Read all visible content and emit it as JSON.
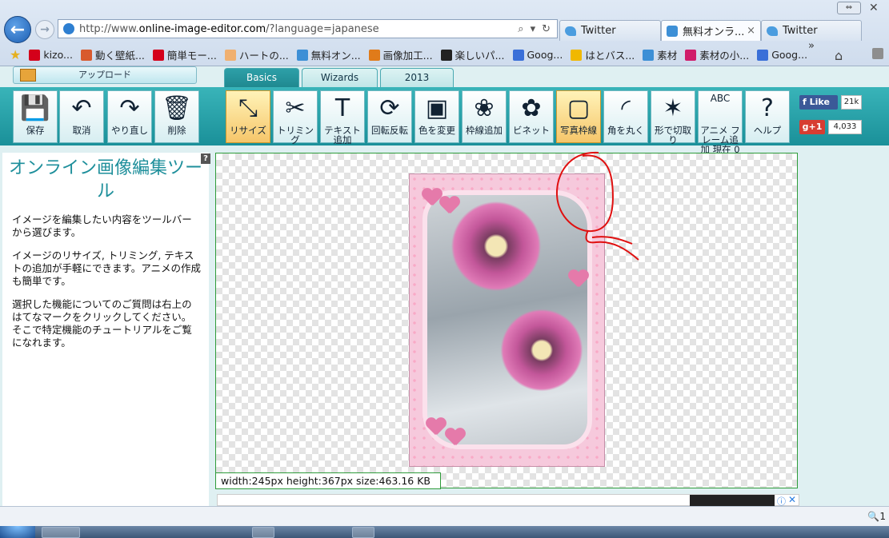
{
  "browser": {
    "url_prefix": "http://www.",
    "url_domain": "online-image-editor.com",
    "url_suffix": "/?language=japanese",
    "tabs": [
      {
        "label": "Twitter",
        "active": false
      },
      {
        "label": "無料オンラ...",
        "active": true
      },
      {
        "label": "Twitter",
        "active": false
      }
    ],
    "tab_close_glyph": "×",
    "favorites": [
      {
        "label": "kizo...",
        "icon": "yahoo-icon",
        "color": "#d4001a"
      },
      {
        "label": "動く壁紙...",
        "icon": "wallpaper-icon",
        "color": "#d85a2e"
      },
      {
        "label": "簡単モー...",
        "icon": "yahoo-icon",
        "color": "#d4001a"
      },
      {
        "label": "ハートの...",
        "icon": "face-icon",
        "color": "#f0b070"
      },
      {
        "label": "無料オン...",
        "icon": "ie-icon",
        "color": "#3c8fd6"
      },
      {
        "label": "画像加工...",
        "icon": "kakou-icon",
        "color": "#e07b1a"
      },
      {
        "label": "楽しいパ...",
        "icon": "x-icon",
        "color": "#222222"
      },
      {
        "label": "Goog...",
        "icon": "google-icon",
        "color": "#3a6fd8"
      },
      {
        "label": "はとバス...",
        "icon": "bus-icon",
        "color": "#f0b800"
      },
      {
        "label": "素材",
        "icon": "ie-icon",
        "color": "#3c8fd6"
      },
      {
        "label": "素材の小...",
        "icon": "m-icon",
        "color": "#d01c6a"
      },
      {
        "label": "Goog...",
        "icon": "google-icon",
        "color": "#3a6fd8"
      }
    ],
    "favorites_more": "»",
    "zoom": "1"
  },
  "editor": {
    "upload_label": "アップロード",
    "mode_tabs": [
      "Basics",
      "Wizards",
      "2013"
    ],
    "tools_left": [
      {
        "label": "保存",
        "icon": "save-icon",
        "glyph": "💾"
      },
      {
        "label": "取消",
        "icon": "undo-icon",
        "glyph": "↶"
      },
      {
        "label": "やり直し",
        "icon": "redo-icon",
        "glyph": "↷"
      },
      {
        "label": "削除",
        "icon": "delete-icon",
        "glyph": "🗑"
      }
    ],
    "tools_main": [
      {
        "label": "リサイズ",
        "icon": "resize-icon",
        "glyph": "⤡",
        "selected": true
      },
      {
        "label": "トリミング",
        "icon": "scissors-icon",
        "glyph": "✂",
        "selected": false
      },
      {
        "label": "テキスト追加",
        "icon": "text-add-icon",
        "glyph": "T",
        "selected": false
      },
      {
        "label": "回転反転",
        "icon": "rotate-icon",
        "glyph": "⟳",
        "selected": false
      },
      {
        "label": "色を変更",
        "icon": "color-change-icon",
        "glyph": "▣",
        "selected": false
      },
      {
        "label": "枠線追加",
        "icon": "border-icon",
        "glyph": "❀",
        "selected": false
      },
      {
        "label": "ビネット",
        "icon": "vignette-icon",
        "glyph": "✿",
        "selected": false
      },
      {
        "label": "写真枠線",
        "icon": "photo-frame-icon",
        "glyph": "▢",
        "selected": true
      },
      {
        "label": "角を丸く",
        "icon": "round-corner-icon",
        "glyph": "◜",
        "selected": false
      },
      {
        "label": "形で切取り",
        "icon": "shape-cut-icon",
        "glyph": "✶",
        "selected": false
      },
      {
        "label": "アニメ フレーム追加 現在 0",
        "icon": "animation-icon",
        "glyph": "ABC",
        "selected": false
      },
      {
        "label": "ヘルプ",
        "icon": "help-icon",
        "glyph": "?",
        "selected": false
      }
    ],
    "social": {
      "fb_label": "Like",
      "fb_count": "21k",
      "gplus_label": "+1",
      "gplus_count": "4,033"
    },
    "info": {
      "title": "オンライン画像編集ツール",
      "p1": "イメージを編集したい内容をツールバーから選びます。",
      "p2": "イメージのリサイズ, トリミング, テキストの追加が手軽にできます。アニメの作成も簡単です。",
      "p3": "選択した機能についてのご質問は右上のはてなマークをクリックしてください。そこで特定機能のチュートリアルをご覧になれます。",
      "help_mark": "?"
    },
    "image_status": "width:245px  height:367px  size:463.16 KB"
  },
  "annotation_color": "#e01010"
}
